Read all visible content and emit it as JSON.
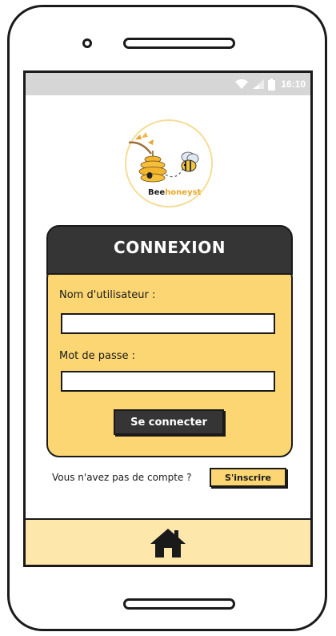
{
  "status_bar": {
    "time": "16:10",
    "icons": [
      "wifi-icon",
      "signal-icon",
      "battery-icon"
    ]
  },
  "logo": {
    "brand_part1": "Bee",
    "brand_part2": "honeyst"
  },
  "login": {
    "title": "CONNEXION",
    "username_label": "Nom d'utilisateur :",
    "username_value": "",
    "password_label": "Mot de passe :",
    "password_value": "",
    "submit_label": "Se connecter"
  },
  "signup": {
    "prompt": "Vous n'avez pas de compte ?",
    "button_label": "S'inscrire"
  },
  "bottom_nav": {
    "home_icon": "home-icon"
  },
  "colors": {
    "honey": "#fbd672",
    "honey_light": "#fde7ab",
    "dark": "#353535",
    "status_bar": "#d6d6d6"
  }
}
